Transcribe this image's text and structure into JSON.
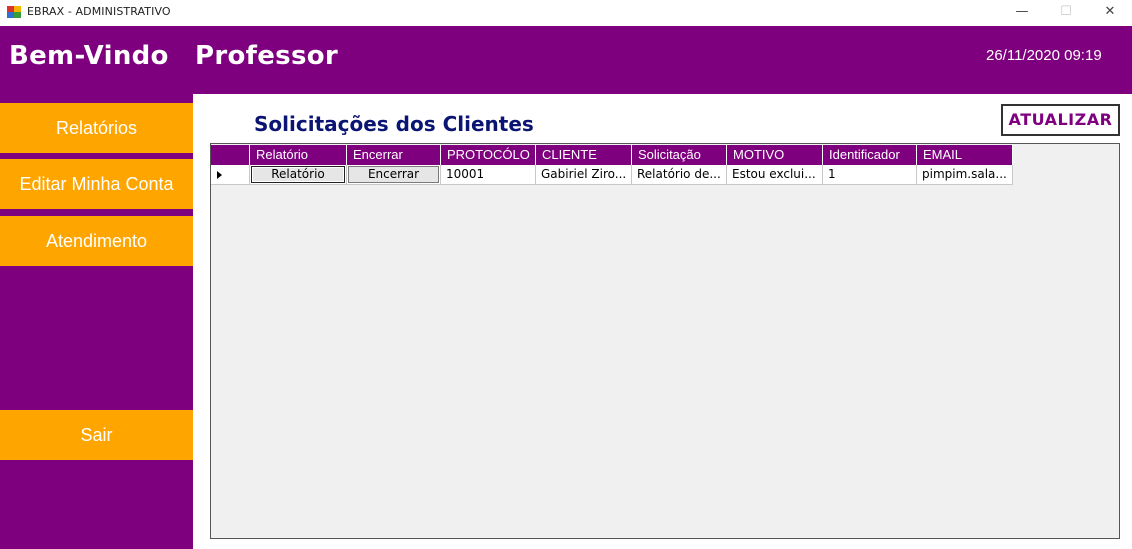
{
  "window": {
    "title": "EBRAX - ADMINISTRATIVO",
    "min_glyph": "—",
    "max_glyph": "☐",
    "close_glyph": "✕"
  },
  "header": {
    "welcome": "Bem-Vindo",
    "user": "Professor",
    "datetime": "26/11/2020 09:19"
  },
  "sidebar": {
    "items": [
      {
        "label": "Relatórios"
      },
      {
        "label": "Editar Minha Conta"
      },
      {
        "label": "Atendimento"
      },
      {
        "label": "Sair"
      }
    ]
  },
  "main": {
    "title": "Solicitações dos Clientes",
    "refresh_label": "ATUALIZAR"
  },
  "table": {
    "columns": [
      "Relatório",
      "Encerrar",
      "PROTOCÓLO",
      "CLIENTE",
      "Solicitação",
      "MOTIVO",
      "Identificador",
      "EMAIL"
    ],
    "rows": [
      {
        "relatorio_btn": "Relatório",
        "encerrar_btn": "Encerrar",
        "protocolo": "10001",
        "cliente": "Gabiriel Ziro...",
        "solicitacao": "Relatório de...",
        "motivo": "Estou exclui...",
        "identificador": "1",
        "email": "pimpim.sala..."
      }
    ]
  },
  "colors": {
    "purple": "#7f007f",
    "orange": "#ffa500",
    "title_blue": "#0a1473"
  }
}
